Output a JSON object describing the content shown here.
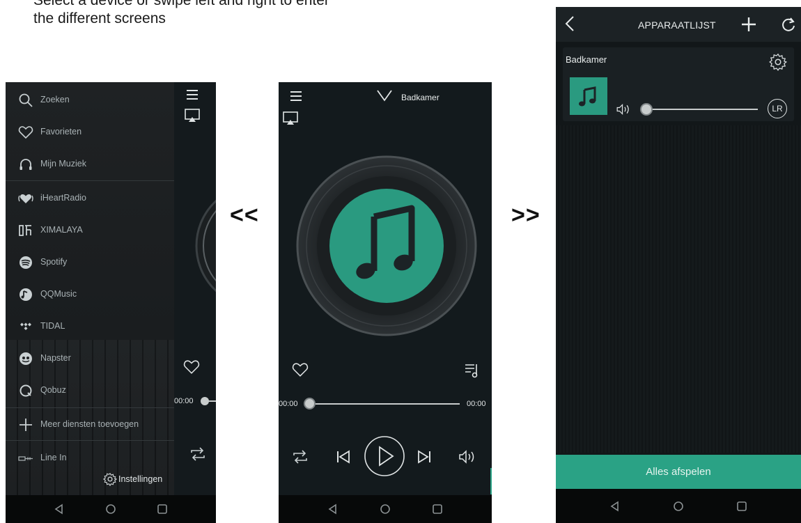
{
  "instruction": {
    "line1": "Select a device or swipe left and right to enter",
    "line2": "the different screens"
  },
  "arrows": {
    "left": "<<",
    "right": ">>"
  },
  "colors": {
    "accent": "#2aa285",
    "album": "#2a9a80",
    "background": "#131a1d",
    "text": "#a9b2b5"
  },
  "left_screen": {
    "menu": [
      {
        "label": "Zoeken",
        "icon": "search-icon"
      },
      {
        "label": "Favorieten",
        "icon": "heart-icon"
      },
      {
        "label": "Mijn Muziek",
        "icon": "headphones-icon"
      },
      {
        "label": "iHeartRadio",
        "icon": "iheartradio-icon"
      },
      {
        "label": "XIMALAYA",
        "icon": "ximalaya-icon"
      },
      {
        "label": "Spotify",
        "icon": "spotify-icon"
      },
      {
        "label": "QQMusic",
        "icon": "qqmusic-icon"
      },
      {
        "label": "TIDAL",
        "icon": "tidal-icon"
      },
      {
        "label": "Napster",
        "icon": "napster-icon"
      },
      {
        "label": "Qobuz",
        "icon": "qobuz-icon"
      },
      {
        "label": "Meer diensten toevoegen",
        "icon": "plus-icon"
      },
      {
        "label": "Line In",
        "icon": "line-in-icon"
      }
    ],
    "settings_label": "Instellingen",
    "peek_time": "00:00"
  },
  "player_screen": {
    "device_name": "Badkamer",
    "time_current": "00:00",
    "time_total": "00:00",
    "progress": 0
  },
  "device_screen": {
    "title": "APPARAATLIJST",
    "device_name": "Badkamer",
    "channel_badge": "LR",
    "volume": 0,
    "play_all_label": "Alles afspelen"
  }
}
